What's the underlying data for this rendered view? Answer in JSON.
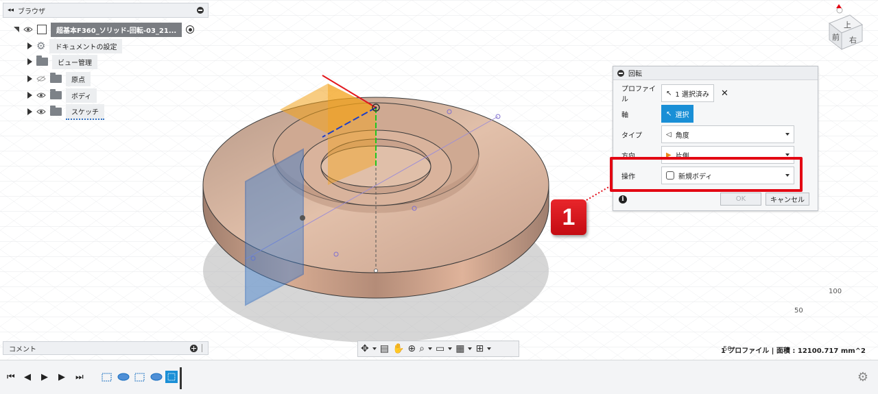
{
  "browser": {
    "title": "ブラウザ",
    "root_label": "超基本F360_ソリッド-回転-03_21...",
    "items": [
      {
        "label": "ドキュメントの設定",
        "icon": "gear-icon"
      },
      {
        "label": "ビュー管理",
        "icon": "folder-icon"
      },
      {
        "label": "原点",
        "icon": "folder-icon"
      },
      {
        "label": "ボディ",
        "icon": "folder-icon"
      },
      {
        "label": "スケッチ",
        "icon": "folder-icon"
      }
    ]
  },
  "comment_bar": {
    "label": "コメント"
  },
  "viewcube": {
    "top": "上",
    "front": "前",
    "right": "右"
  },
  "dialog": {
    "title": "回転",
    "rows": {
      "profile": {
        "label": "プロファイル",
        "value": "1 選択済み"
      },
      "axis": {
        "label": "軸",
        "value": "選択"
      },
      "type": {
        "label": "タイプ",
        "value": "角度"
      },
      "direction": {
        "label": "方向",
        "value": "片側"
      },
      "operation": {
        "label": "操作",
        "value": "新規ボディ"
      }
    },
    "ok_label": "OK",
    "cancel_label": "キャンセル"
  },
  "callout": {
    "number": "1",
    "color": "#e30613"
  },
  "status_text": "1 プロファイル | 面積 : 12100.717 mm^2",
  "grid_labels": [
    "100",
    "50",
    "50"
  ],
  "colors": {
    "accent": "#1a8fd6",
    "highlight": "#e30613",
    "body": "#c79a80"
  }
}
